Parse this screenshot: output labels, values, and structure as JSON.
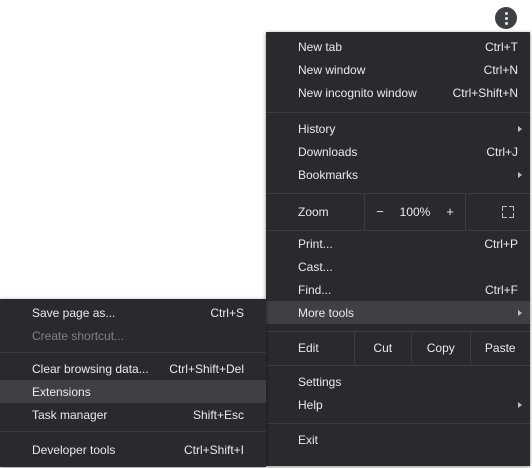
{
  "main_menu": {
    "new_tab": {
      "label": "New tab",
      "shortcut": "Ctrl+T"
    },
    "new_window": {
      "label": "New window",
      "shortcut": "Ctrl+N"
    },
    "new_incognito": {
      "label": "New incognito window",
      "shortcut": "Ctrl+Shift+N"
    },
    "history": {
      "label": "History"
    },
    "downloads": {
      "label": "Downloads",
      "shortcut": "Ctrl+J"
    },
    "bookmarks": {
      "label": "Bookmarks"
    },
    "zoom": {
      "label": "Zoom",
      "minus": "−",
      "value": "100%",
      "plus": "+"
    },
    "print": {
      "label": "Print...",
      "shortcut": "Ctrl+P"
    },
    "cast": {
      "label": "Cast..."
    },
    "find": {
      "label": "Find...",
      "shortcut": "Ctrl+F"
    },
    "more_tools": {
      "label": "More tools"
    },
    "edit": {
      "label": "Edit",
      "cut": "Cut",
      "copy": "Copy",
      "paste": "Paste"
    },
    "settings": {
      "label": "Settings"
    },
    "help": {
      "label": "Help"
    },
    "exit": {
      "label": "Exit"
    }
  },
  "submenu": {
    "save_page": {
      "label": "Save page as...",
      "shortcut": "Ctrl+S"
    },
    "create_shortcut": {
      "label": "Create shortcut..."
    },
    "clear_browsing": {
      "label": "Clear browsing data...",
      "shortcut": "Ctrl+Shift+Del"
    },
    "extensions": {
      "label": "Extensions"
    },
    "task_manager": {
      "label": "Task manager",
      "shortcut": "Shift+Esc"
    },
    "developer_tools": {
      "label": "Developer tools",
      "shortcut": "Ctrl+Shift+I"
    }
  },
  "icons": {
    "menu_button": "three-dots-vertical-icon",
    "submenu_arrow": "chevron-right-icon",
    "fullscreen": "fullscreen-icon"
  },
  "colors": {
    "menu_bg": "#292a2d",
    "highlight": "#3f4043",
    "text": "#e8eaed",
    "disabled_text": "#7f8286"
  }
}
